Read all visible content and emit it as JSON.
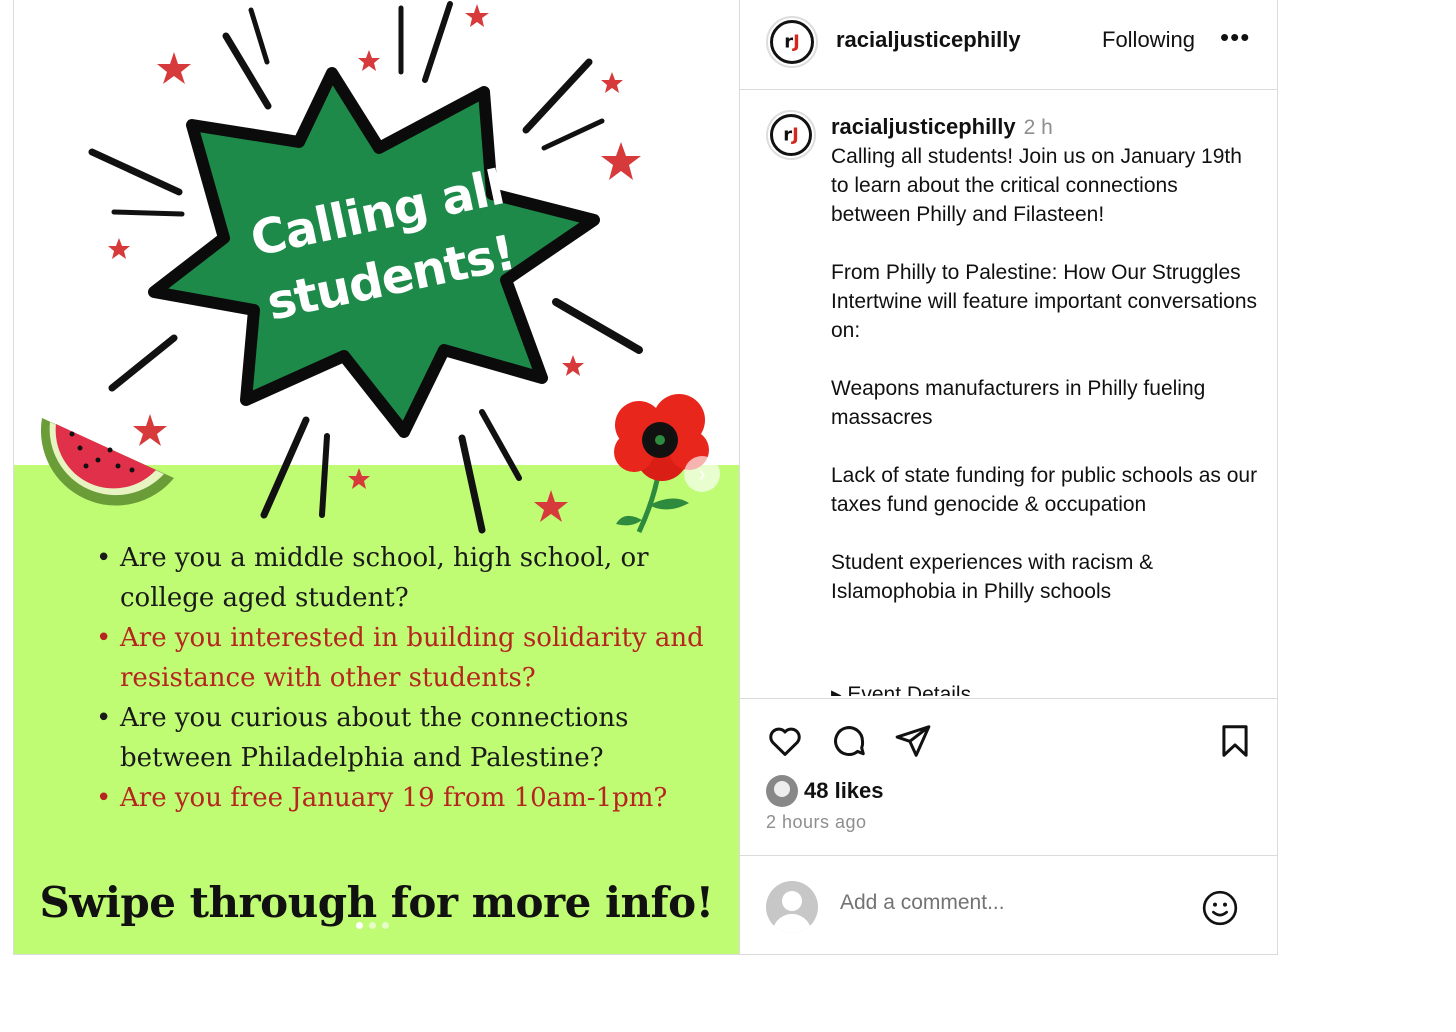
{
  "poster": {
    "burst_text_line1": "Calling all",
    "burst_text_line2": "students!",
    "questions": [
      {
        "text": "Are you a middle school, high school, or college aged student?",
        "color": "#1a1a1a"
      },
      {
        "text": "Are you interested in building solidarity and resistance with other students?",
        "color": "#b5261e"
      },
      {
        "text": "Are you curious about the connections between Philadelphia and Palestine?",
        "color": "#1a1a1a"
      },
      {
        "text": "Are you free January 19 from 10am-1pm?",
        "color": "#b5261e"
      }
    ],
    "swipe_text": "Swipe through for more info!",
    "carousel_count": 3,
    "carousel_active": 1,
    "colors": {
      "burst_green": "#1e8a4a",
      "band": "#c0fb74",
      "star": "#d63a3a"
    }
  },
  "header": {
    "username": "racialjusticephilly",
    "follow_label": "Following",
    "more_label": "•••"
  },
  "post": {
    "username": "racialjusticephilly",
    "time": "2 h",
    "paragraphs": [
      "Calling all students! Join us on January 19th to learn about the critical connections between Philly and Filasteen!",
      "From Philly to Palestine: How Our Struggles Intertwine will feature important conversations on:",
      "Weapons manufacturers in Philly fueling massacres",
      "Lack of state funding for public schools as our taxes fund genocide & occupation",
      "Student experiences with racism & Islamophobia in Philly schools"
    ],
    "cut_off_line": "▸ Event Details"
  },
  "engagement": {
    "likes_label": "48 likes",
    "time_ago": "2 hours ago"
  },
  "comment": {
    "placeholder": "Add a comment..."
  }
}
